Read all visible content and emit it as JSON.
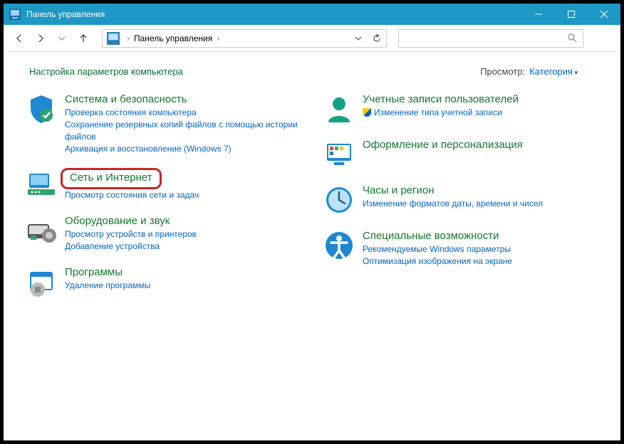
{
  "titlebar": {
    "title": "Панель управления"
  },
  "breadcrumb": {
    "root": "Панель управления"
  },
  "header": {
    "title": "Настройка параметров компьютера",
    "view_label": "Просмотр:",
    "view_value": "Категория"
  },
  "left": [
    {
      "id": "system-security",
      "title": "Система и безопасность",
      "links": [
        "Проверка состояния компьютера",
        "Сохранение резервных копий файлов с помощью истории файлов",
        "Архивация и восстановление (Windows 7)"
      ]
    },
    {
      "id": "network-internet",
      "title": "Сеть и Интернет",
      "highlight": true,
      "links": [
        "Просмотр состояния сети и задач"
      ]
    },
    {
      "id": "hardware-sound",
      "title": "Оборудование и звук",
      "links": [
        "Просмотр устройств и принтеров",
        "Добавление устройства"
      ]
    },
    {
      "id": "programs",
      "title": "Программы",
      "links": [
        "Удаление программы"
      ]
    }
  ],
  "right": [
    {
      "id": "user-accounts",
      "title": "Учетные записи пользователей",
      "links": [
        "Изменение типа учетной записи"
      ],
      "shield": true
    },
    {
      "id": "appearance",
      "title": "Оформление и персонализация",
      "links": []
    },
    {
      "id": "clock-region",
      "title": "Часы и регион",
      "links": [
        "Изменение форматов даты, времени и чисел"
      ]
    },
    {
      "id": "ease-of-access",
      "title": "Специальные возможности",
      "links": [
        "Рекомендуемые Windows параметры",
        "Оптимизация изображения на экране"
      ]
    }
  ]
}
